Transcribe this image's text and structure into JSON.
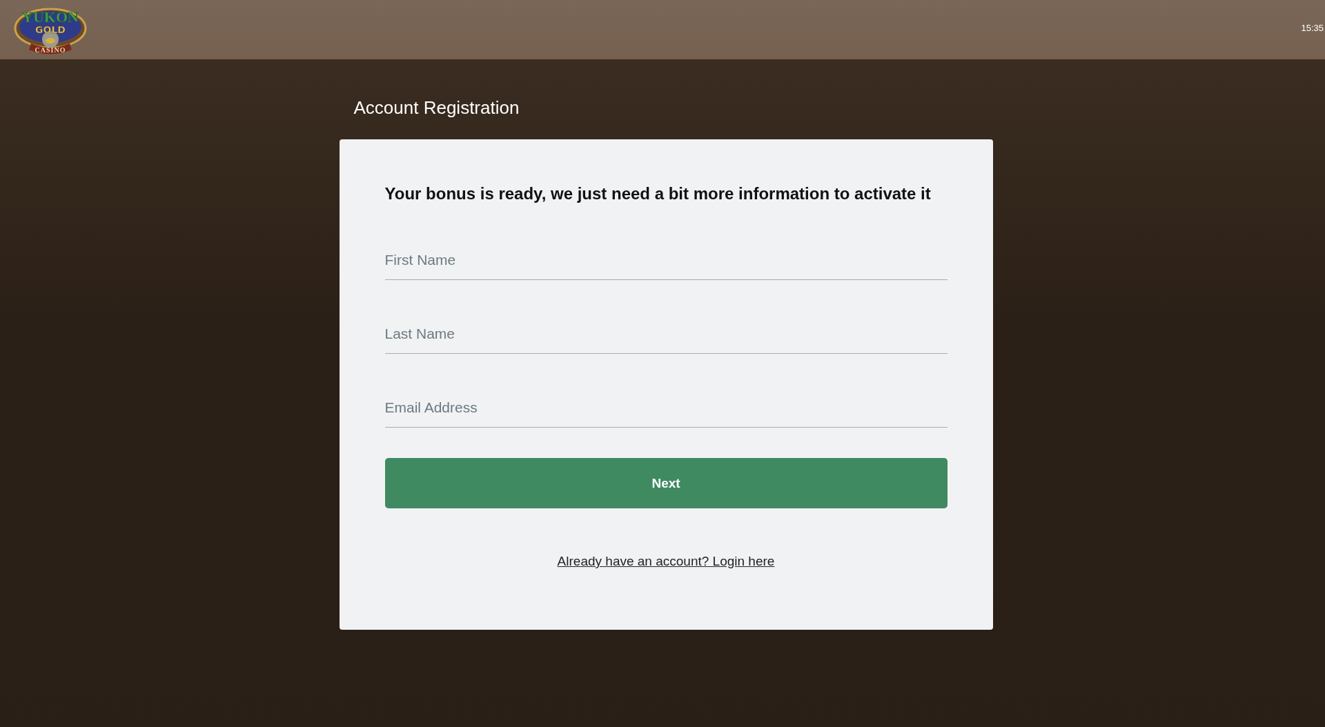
{
  "header": {
    "logo": {
      "top": "YUKON",
      "middle": "GOLD",
      "bottom": "CASINO"
    },
    "time": "15:35"
  },
  "page_title": "Account Registration",
  "form": {
    "heading": "Your bonus is ready, we just need a bit more information to activate it",
    "fields": [
      {
        "placeholder": "First Name"
      },
      {
        "placeholder": "Last Name"
      },
      {
        "placeholder": "Email Address"
      }
    ],
    "submit": "Next",
    "login_link": "Already have an account? Login here"
  }
}
